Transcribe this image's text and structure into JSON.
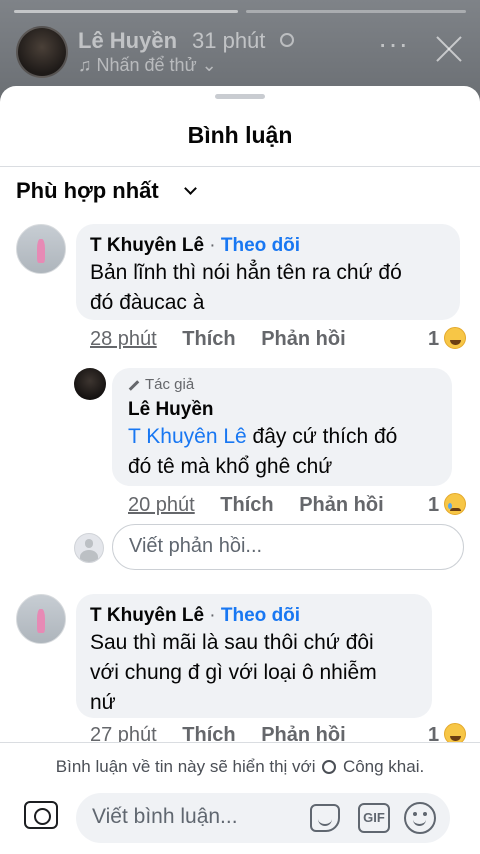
{
  "story": {
    "author": "Lê Huyền",
    "time": "31 phút",
    "music": "♫ Nhấn để thử ⌄",
    "more_glyph": "···",
    "progress_segments": [
      1.0,
      0.0
    ]
  },
  "sheet": {
    "title": "Bình luận",
    "sort_label": "Phù hợp nhất"
  },
  "comments": [
    {
      "author": "T Khuyên Lê",
      "separator": " · ",
      "follow_label": "Theo dõi",
      "lines": [
        "Bản lĩnh thì nói hẳn tên ra chứ đó",
        "đó đàucac à"
      ],
      "time": "28 phút",
      "like_label": "Thích",
      "reply_label": "Phản hồi",
      "reaction_count": "1",
      "reaction_icon": "laugh-emoji-icon"
    },
    {
      "author_tag": "Tác giả",
      "author": "Lê Huyền",
      "mention": "T Khuyên Lê",
      "line1_rest": " đây cứ thích đó",
      "line2": "đó tê mà khổ ghê chứ",
      "time": "20 phút",
      "like_label": "Thích",
      "reply_label": "Phản hồi",
      "reaction_count": "1",
      "reaction_icon": "sad-emoji-icon"
    },
    {
      "author": "T Khuyên Lê",
      "separator": " · ",
      "follow_label": "Theo dõi",
      "lines": [
        "Sau thì mãi là sau thôi chứ đôi",
        "với chung đ gì với loại ô nhiễm",
        "nứ"
      ],
      "time": "27 phút",
      "like_label": "Thích",
      "reply_label": "Phản hồi",
      "reaction_count": "1",
      "reaction_icon": "laugh-emoji-icon"
    }
  ],
  "reply_box": {
    "placeholder": "Viết phản hồi..."
  },
  "footer": {
    "notice_before": "Bình luận về tin này sẽ hiển thị với ",
    "notice_after": "Công khai.",
    "placeholder": "Viết bình luận...",
    "gif_label": "GIF"
  },
  "colors": {
    "link": "#1877f2",
    "bubble": "#f0f2f5",
    "muted": "#65676b"
  }
}
